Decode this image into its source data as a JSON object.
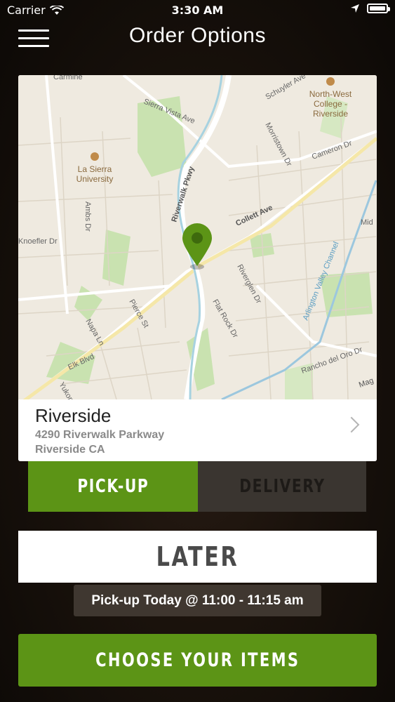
{
  "status_bar": {
    "carrier": "Carrier",
    "time": "3:30 AM"
  },
  "header": {
    "title": "Order Options"
  },
  "map": {
    "labels": {
      "carmine": "Carmine",
      "sierra_vista": "Sierra Vista Ave",
      "schuyler": "Schuyler Ave",
      "nwc1": "North-West",
      "nwc2": "College -",
      "nwc3": "Riverside",
      "morristown": "Morristown Dr",
      "cameron": "Cameron Dr",
      "lsu1": "La Sierra",
      "lsu2": "University",
      "riverwalk": "Riverwalk Pkwy",
      "collett": "Collett Ave",
      "ambs": "Ambs Dr",
      "knoefler": "Knoefler Dr",
      "mid": "Mid",
      "arlington": "Arlington Valley Channel",
      "riverglen": "Riverglen Dr",
      "pierce": "Pierce St",
      "flatrock": "Flat Rock Dr",
      "napa": "Napa Ln",
      "elk": "Elk Blvd",
      "yukon": "Yukon",
      "rancho": "Rancho del Oro Dr",
      "mag": "Mag"
    }
  },
  "location": {
    "name": "Riverside",
    "address_line1": "4290 Riverwalk Parkway",
    "address_line2": "Riverside CA"
  },
  "tabs": {
    "pickup": "PICK-UP",
    "delivery": "DELIVERY"
  },
  "later_label": "LATER",
  "pickup_time": "Pick-up Today @ 11:00 - 11:15 am",
  "choose_label": "CHOOSE YOUR ITEMS",
  "colors": {
    "accent": "#5c9416"
  }
}
